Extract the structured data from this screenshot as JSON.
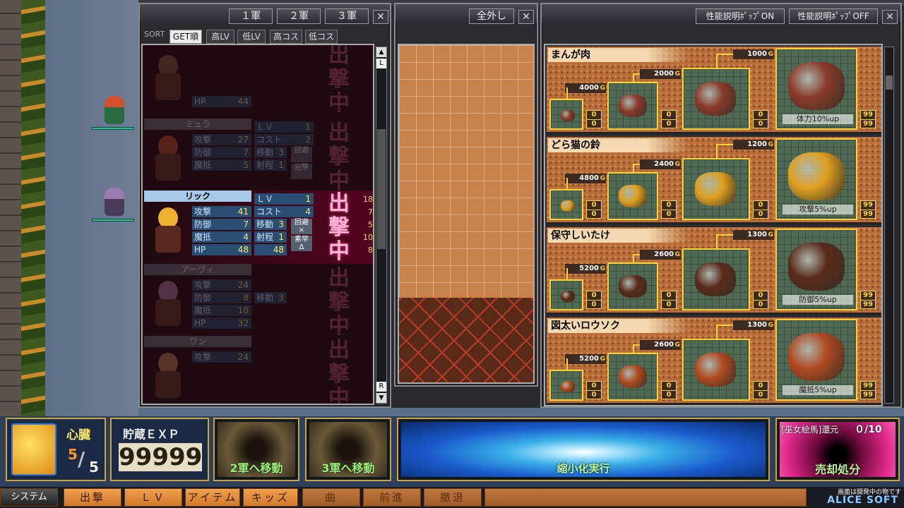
{
  "army_window": {
    "tabs": [
      "１軍",
      "２軍",
      "３軍"
    ],
    "close_label": "✕",
    "sort_label": "SORT",
    "sort_buttons": [
      "GET順",
      "高LV",
      "低LV",
      "高コスト",
      "低コスト"
    ],
    "sortie_text": "出撃中",
    "scroll_top": "L",
    "scroll_bottom": "R",
    "stat_labels": {
      "lv": "ＬＶ",
      "atk": "攻撃",
      "cost": "コスト",
      "def": "防御",
      "move": "移動",
      "res": "魔抵",
      "range": "射程",
      "hp": "HP"
    },
    "units": [
      {
        "name": "",
        "lv": "",
        "atk": "",
        "cost": "",
        "def": "",
        "move": "",
        "res": "",
        "range": "",
        "hp": "44",
        "hp_max": "",
        "dim": true
      },
      {
        "name": "ミュラ",
        "lv": "1",
        "atk": "27",
        "cost": "2",
        "def": "7",
        "move": "3",
        "res": "5",
        "range": "1",
        "hp": "",
        "hp_max": "",
        "dim": true,
        "tags": [
          "回避",
          "迎撃"
        ]
      },
      {
        "name": "リック",
        "lv": "1",
        "atk": "41",
        "cost": "4",
        "def": "7",
        "move": "3",
        "res": "4",
        "range": "1",
        "hp": "48",
        "hp_max": "48",
        "dim": false,
        "tags": [
          "回避 ×",
          "素早 Δ"
        ],
        "pcts": [
          "18",
          "7",
          "5",
          "10",
          "8"
        ]
      },
      {
        "name": "アーヴィ",
        "lv": "",
        "atk": "24",
        "cost": "",
        "def": "8",
        "move": "3",
        "res": "10",
        "range": "",
        "hp": "32",
        "hp_max": "",
        "dim": true
      },
      {
        "name": "ワン",
        "lv": "",
        "atk": "24",
        "cost": "",
        "def": "",
        "move": "",
        "res": "",
        "range": "",
        "hp": "",
        "hp_max": "",
        "dim": true
      }
    ]
  },
  "board_window": {
    "release_all": "全外し",
    "close_label": "✕"
  },
  "item_window": {
    "popup_on": "性能説明ﾎﾟｯﾌﾟON",
    "popup_off": "性能説明ﾎﾟｯﾌﾟOFF",
    "close_label": "✕",
    "items": [
      {
        "name": "まんが肉",
        "prices": [
          "4000",
          "2000",
          "1000"
        ],
        "effect": "体力10%up",
        "color": "#8a3a2a",
        "counts": [
          "0",
          "0",
          "0",
          "0",
          "0",
          "0",
          "99",
          "99"
        ]
      },
      {
        "name": "どら猫の鈴",
        "prices": [
          "4800",
          "2400",
          "1200"
        ],
        "effect": "攻撃5%up",
        "color": "#e0a020",
        "counts": [
          "0",
          "0",
          "0",
          "0",
          "0",
          "0",
          "99",
          "99"
        ]
      },
      {
        "name": "保守しいたけ",
        "prices": [
          "5200",
          "2600",
          "1300"
        ],
        "effect": "防御5%up",
        "color": "#5a2a1a",
        "counts": [
          "0",
          "0",
          "0",
          "0",
          "0",
          "0",
          "99",
          "99"
        ]
      },
      {
        "name": "図太いロウソク",
        "prices": [
          "5200",
          "2600",
          "1300"
        ],
        "effect": "魔抵5%up",
        "color": "#b04a20",
        "counts": [
          "0",
          "0",
          "0",
          "0",
          "0",
          "0",
          "99",
          "99"
        ]
      }
    ]
  },
  "bottom_bar": {
    "heart_label": "心臓",
    "heart_current": "5",
    "heart_max": "5",
    "exp_label": "貯蔵ＥＸＰ",
    "exp_value": "99999",
    "move2": "2軍へ移動",
    "move3": "3軍へ移動",
    "shrink": "縮小化実行",
    "return_label": "[巫女絵馬]還元",
    "return_count": "０/10",
    "sell": "売却処分"
  },
  "menu": {
    "system": "システム",
    "items": [
      "出撃",
      "ＬＶ",
      "アイテム",
      "キッズ",
      "曲",
      "前進",
      "撤退"
    ],
    "notice": "画面は開発中の物です",
    "logo": "ALICE SOFT"
  }
}
